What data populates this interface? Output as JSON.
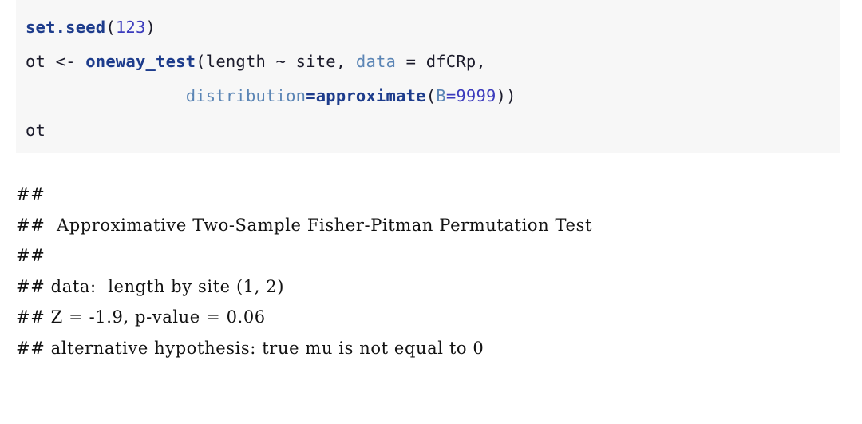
{
  "theme": {
    "page_background": "#ffffff",
    "code_background": "#f7f7f7",
    "function_color": "#1d3c8c",
    "number_color": "#3b3bbd",
    "argument_color": "#5b85b5",
    "plain_code_color": "#1b1b2b",
    "output_color": "#121212"
  },
  "code_chunk": {
    "language": "r",
    "line1": {
      "fn": "set.seed",
      "open_paren": "(",
      "num": "123",
      "close_paren": ")"
    },
    "line2": {
      "prefix": "ot <- ",
      "fn": "oneway_test",
      "mid": "(length ~ site, ",
      "arg": "data",
      "suffix": " = dfCRp,"
    },
    "line3": {
      "indent": "                ",
      "arg": "distribution",
      "equals": "=",
      "fn": "approximate",
      "open_paren": "(",
      "arg2": "B",
      "equals2": "=",
      "num": "9999",
      "close": "))"
    },
    "line4": {
      "text": "ot"
    }
  },
  "output": {
    "lines": [
      "##",
      "##  Approximative Two-Sample Fisher-Pitman Permutation Test",
      "##",
      "## data:  length by site (1, 2)",
      "## Z = -1.9, p-value = 0.06",
      "## alternative hypothesis: true mu is not equal to 0"
    ]
  }
}
